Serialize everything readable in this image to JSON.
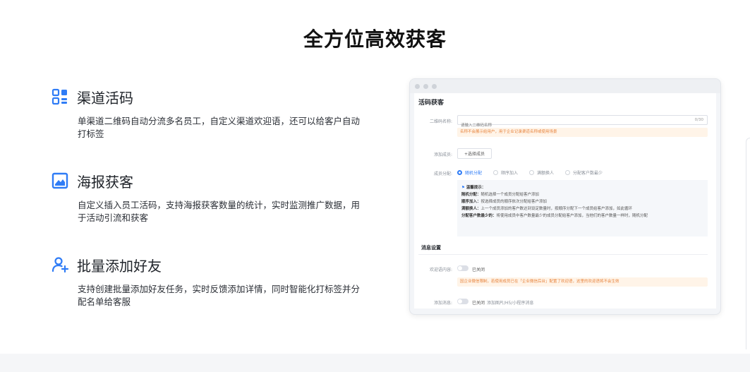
{
  "title": "全方位高效获客",
  "features": [
    {
      "icon": "qrcode-grid-icon",
      "title": "渠道活码",
      "desc": "单渠道二维码自动分流多名员工，自定义渠道欢迎语，还可以给客户自动打标签"
    },
    {
      "icon": "poster-image-icon",
      "title": "海报获客",
      "desc": "自定义插入员工活码，支持海报获客数量的统计，实时监测推广数据，用于活动引流和获客"
    },
    {
      "icon": "add-friend-icon",
      "title": "批量添加好友",
      "desc": "支持创建批量添加好友任务，实时反馈添加详情，同时智能化打标签并分配名单给客服"
    }
  ],
  "accent_color": "#2f7cf6",
  "mock": {
    "section1": "活码获客",
    "qr_label": "二维码名称:",
    "qr_placeholder": "请输入二维码名称",
    "qr_count": "0/30",
    "qr_warning": "名称不会展示给用户，用于企业记录渠道名称或使用场景",
    "add_member_label": "添加成员:",
    "add_member_btn": "+选择成员",
    "assign_label": "成员分配:",
    "assign_options": [
      "随机分配",
      "顺序加入",
      "满额换人",
      "分配客户数最少"
    ],
    "tips_title": "温馨提示：",
    "tips": [
      {
        "k": "随机分配：",
        "v": "随机选择一个成员分配给客户添加"
      },
      {
        "k": "顺序加入：",
        "v": "按选择成员的顺序依次分配给客户添加"
      },
      {
        "k": "满额换人：",
        "v": "上一个成员添加的客户数达到设定数量时，按顺序分配下一个成员给客户添加，如此循环"
      },
      {
        "k": "分配客户数最少的：",
        "v": "将使用成员中客户数量最少的成员分配给客户添加，当他们的客户数量一样时，随机分配"
      }
    ],
    "section2": "消息设置",
    "welcome_label": "欢迎语内容:",
    "welcome_status": "已关闭",
    "welcome_warning": "因企业微信限制，若使用成员已在「企业微信后台」配置了欢迎语，这里的欢迎语将不会生效",
    "add_msg_label": "添加消息:",
    "add_msg_status": "已关闭",
    "add_msg_extra": "添加图片/H5/小程序消息"
  }
}
